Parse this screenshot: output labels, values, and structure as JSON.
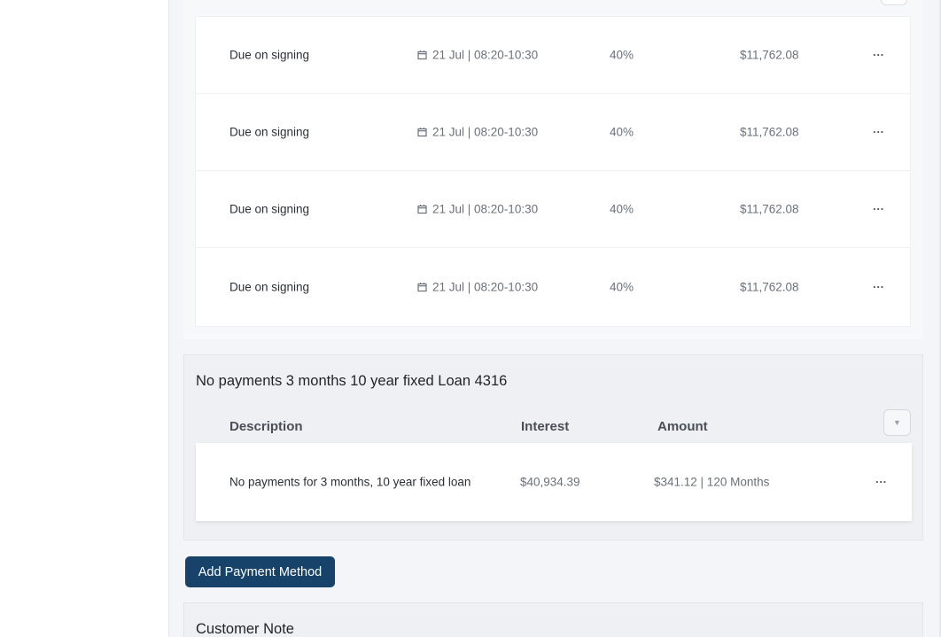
{
  "schedule": {
    "rows": [
      {
        "description": "Due on signing",
        "date": "21 Jul | 08:20-10:30",
        "percent": "40%",
        "amount": "$11,762.08",
        "more": "···"
      },
      {
        "description": "Due on signing",
        "date": "21 Jul | 08:20-10:30",
        "percent": "40%",
        "amount": "$11,762.08",
        "more": "···"
      },
      {
        "description": "Due on signing",
        "date": "21 Jul | 08:20-10:30",
        "percent": "40%",
        "amount": "$11,762.08",
        "more": "···"
      },
      {
        "description": "Due on signing",
        "date": "21 Jul | 08:20-10:30",
        "percent": "40%",
        "amount": "$11,762.08",
        "more": "···"
      }
    ]
  },
  "loan": {
    "title": "No payments 3 months 10 year fixed Loan 4316",
    "headers": {
      "description": "Description",
      "interest": "Interest",
      "amount": "Amount"
    },
    "dropdown_glyph": "▼",
    "row": {
      "description": "No payments for 3 months, 10 year fixed loan",
      "interest": "$40,934.39",
      "amount": "$341.12 | 120 Months",
      "more": "···"
    }
  },
  "actions": {
    "add_payment_method": "Add Payment Method"
  },
  "note": {
    "title": "Customer Note"
  },
  "colors": {
    "primary_button": "#17436b",
    "page_bg": "#f3f5f9"
  }
}
